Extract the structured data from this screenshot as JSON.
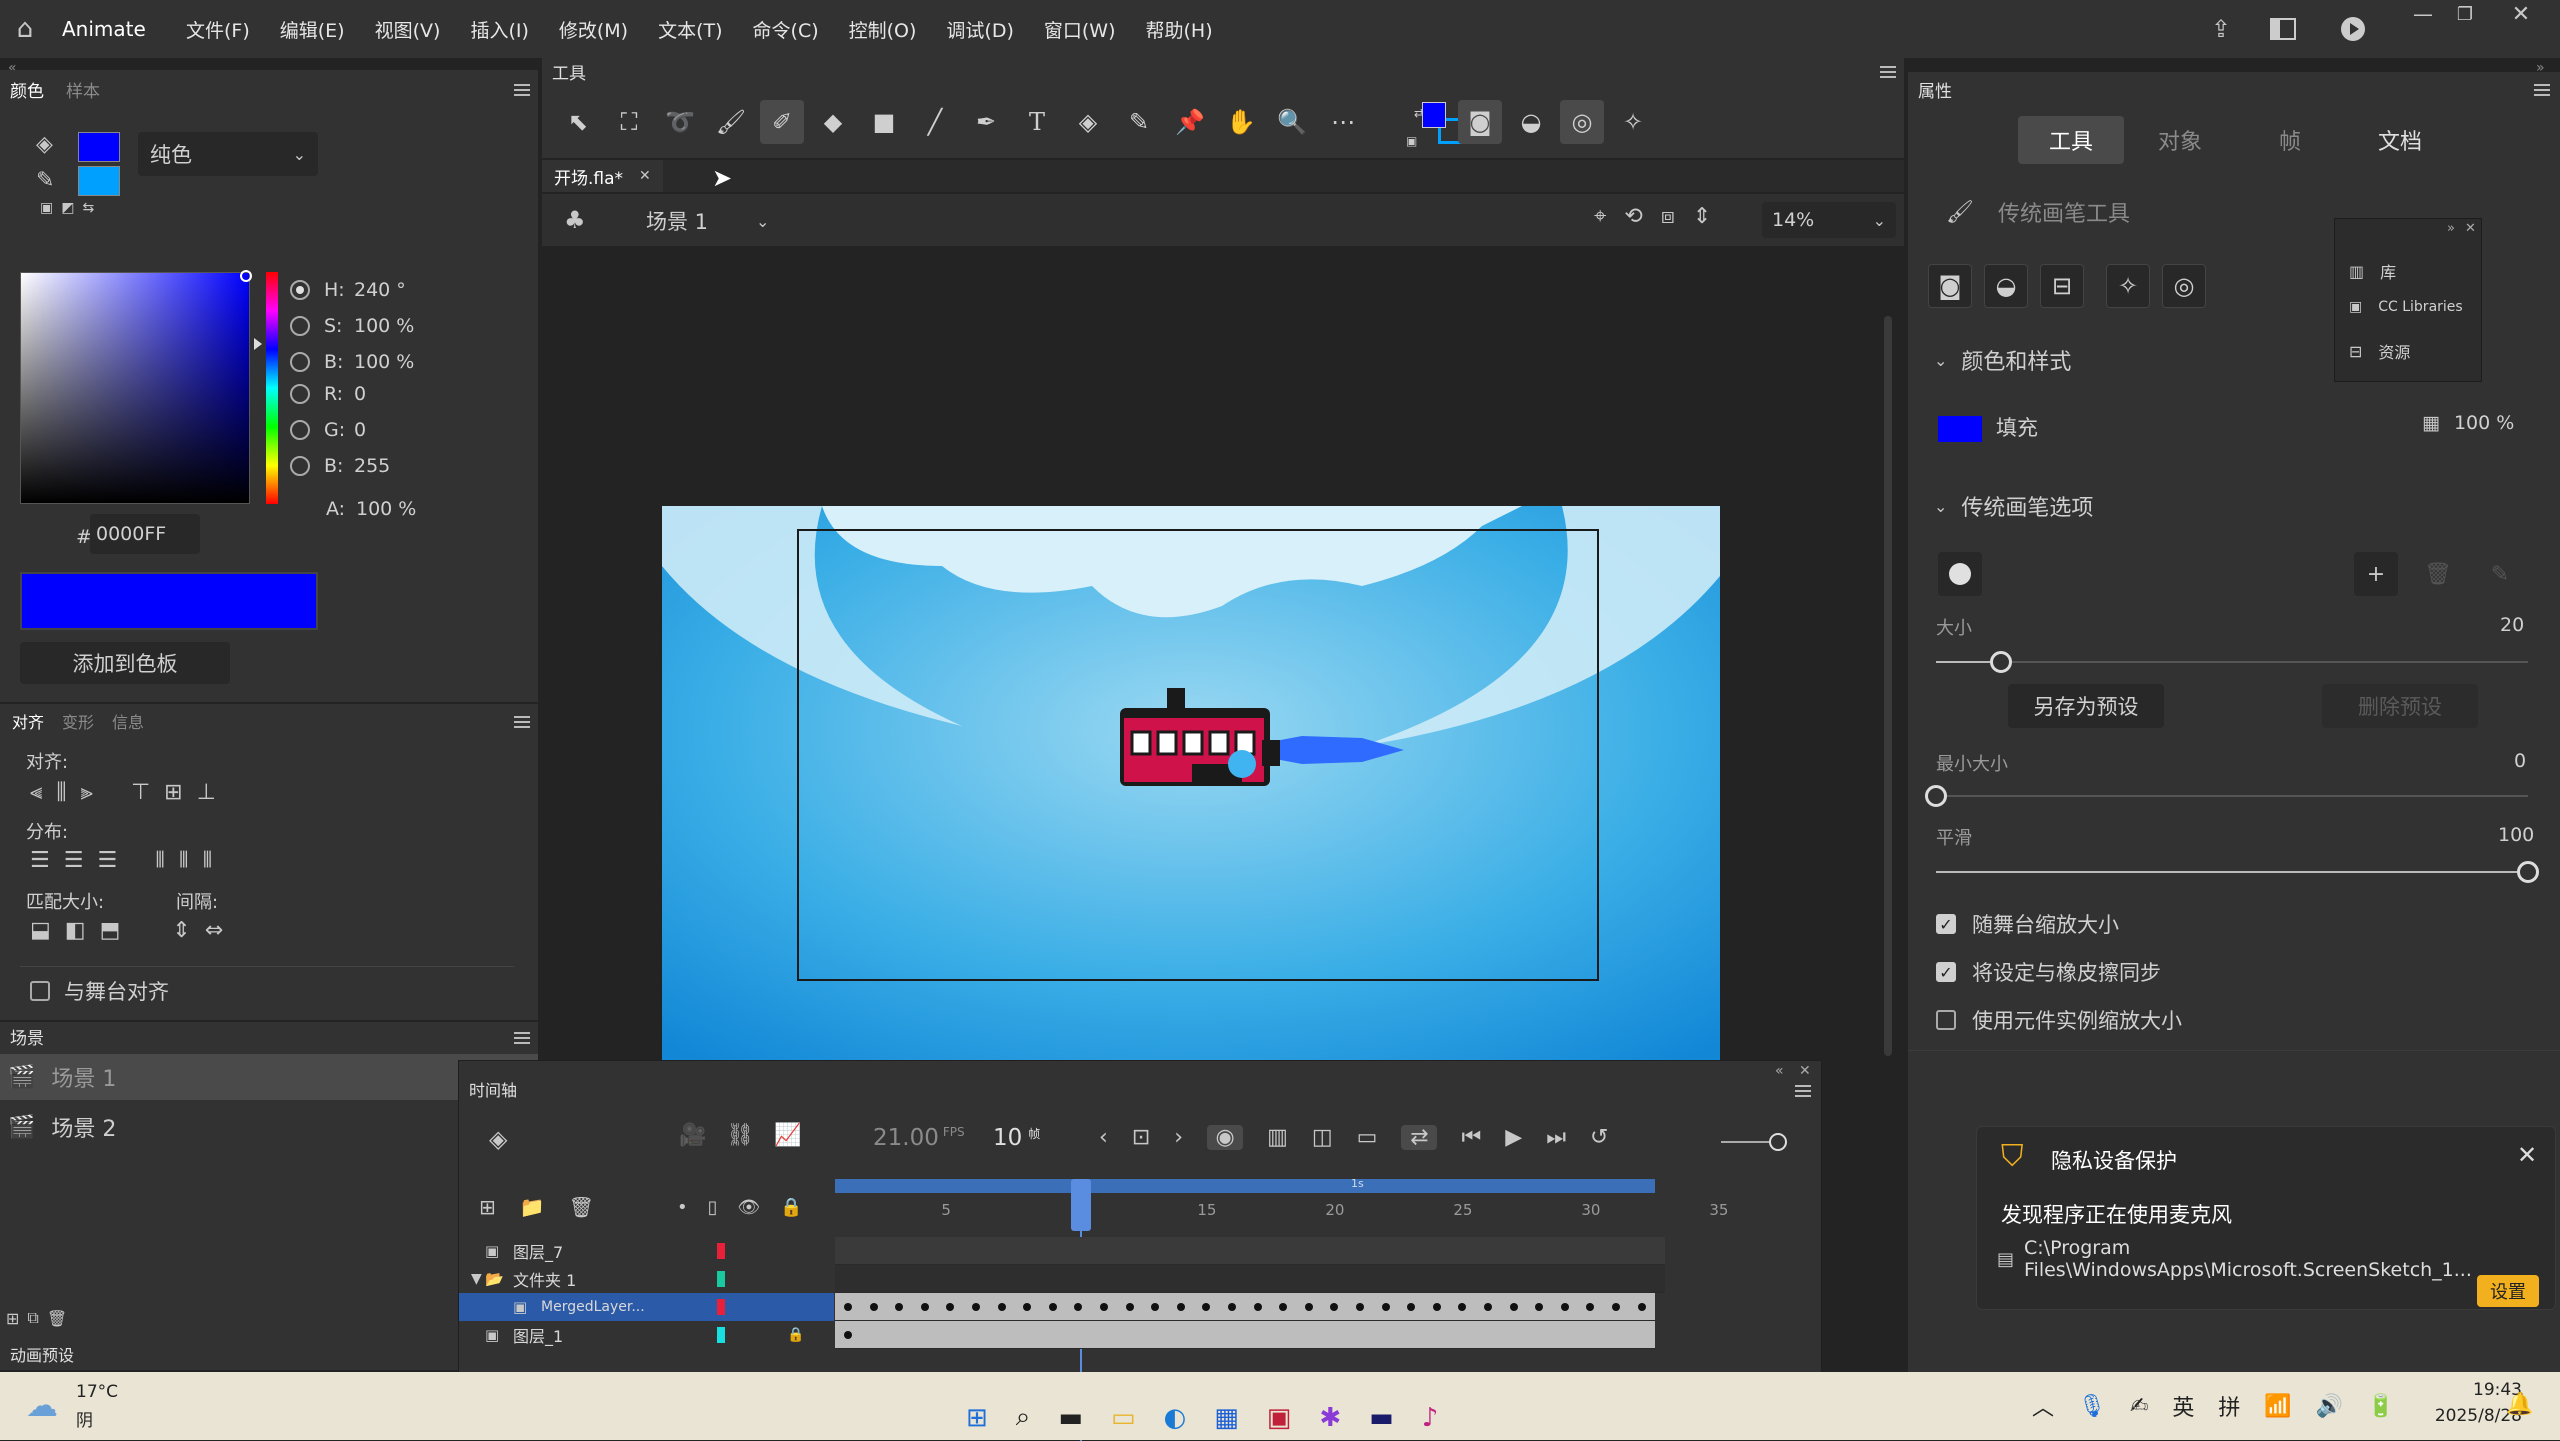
{
  "app": {
    "name": "Animate"
  },
  "menu": [
    "文件(F)",
    "编辑(E)",
    "视图(V)",
    "插入(I)",
    "修改(M)",
    "文本(T)",
    "命令(C)",
    "控制(O)",
    "调试(D)",
    "窗口(W)",
    "帮助(H)"
  ],
  "color_panel": {
    "tabs": [
      "颜色",
      "样本"
    ],
    "fill_type": "纯色",
    "hsb": [
      {
        "label": "H:",
        "value": "240 °"
      },
      {
        "label": "S:",
        "value": "100 %"
      },
      {
        "label": "B:",
        "value": "100 %"
      }
    ],
    "rgb": [
      {
        "label": "R:",
        "value": "0"
      },
      {
        "label": "G:",
        "value": "0"
      },
      {
        "label": "B:",
        "value": "255"
      }
    ],
    "alpha": {
      "label": "A:",
      "value": "100 %"
    },
    "hex_prefix": "#",
    "hex": "0000FF",
    "add_swatch": "添加到色板",
    "current_color": "#0000ff",
    "stroke_color": "#00a0ff"
  },
  "align_panel": {
    "tabs": [
      "对齐",
      "变形",
      "信息"
    ],
    "align_label": "对齐:",
    "distribute_label": "分布:",
    "match_size_label": "匹配大小:",
    "spacing_label": "间隔:",
    "stage_align": "与舞台对齐"
  },
  "scene_panel": {
    "title": "场景",
    "scenes": [
      "场景 1",
      "场景 2"
    ]
  },
  "motion_presets": {
    "title": "动画预设"
  },
  "tools_panel": {
    "title": "工具"
  },
  "document": {
    "tab": "开场.fla*",
    "scene": "场景 1",
    "zoom": "14%"
  },
  "timeline": {
    "title": "时间轴",
    "fps": "21.00",
    "fps_unit": "FPS",
    "frame": "10",
    "frame_unit": "帧",
    "ruler": [
      "5",
      "15",
      "20",
      "25",
      "30",
      "35"
    ],
    "span_label": "1s",
    "layers": [
      {
        "name": "图层_7",
        "color": "#e8203a",
        "indent": 0,
        "selected": false,
        "folder": false,
        "locked": false
      },
      {
        "name": "文件夹 1",
        "color": "#19c9a0",
        "indent": 0,
        "selected": false,
        "folder": true,
        "locked": false
      },
      {
        "name": "MergedLayer...",
        "color": "#e8203a",
        "indent": 1,
        "selected": true,
        "folder": false,
        "locked": false
      },
      {
        "name": "图层_1",
        "color": "#19e0e0",
        "indent": 0,
        "selected": false,
        "folder": false,
        "locked": true
      }
    ]
  },
  "properties": {
    "title": "属性",
    "tabs": [
      "工具",
      "对象",
      "帧",
      "文档"
    ],
    "tool_name": "传统画笔工具",
    "section_color": "颜色和样式",
    "fill_label": "填充",
    "fill_alpha": "100 %",
    "section_brush": "传统画笔选项",
    "size_label": "大小",
    "size_value": "20",
    "size_fraction": 0.11,
    "save_preset": "另存为预设",
    "delete_preset": "删除预设",
    "min_size_label": "最小大小",
    "min_size_value": "0",
    "min_size_fraction": 0,
    "smooth_label": "平滑",
    "smooth_value": "100",
    "smooth_fraction": 1,
    "checkboxes": [
      {
        "label": "随舞台缩放大小",
        "checked": true
      },
      {
        "label": "将设定与橡皮擦同步",
        "checked": true
      },
      {
        "label": "使用元件实例缩放大小",
        "checked": false
      }
    ]
  },
  "library_popup": {
    "items": [
      "库",
      "CC Libraries",
      "资源"
    ]
  },
  "notification": {
    "title": "隐私设备保护",
    "message": "发现程序正在使用麦克风",
    "path": "C:\\Program Files\\WindowsApps\\Microsoft.ScreenSketch_1...",
    "button": "设置"
  },
  "taskbar": {
    "weather_temp": "17°C",
    "weather_desc": "阴",
    "ime_lang": "英",
    "ime_mode": "拼",
    "time": "19:43",
    "date": "2025/8/28"
  }
}
